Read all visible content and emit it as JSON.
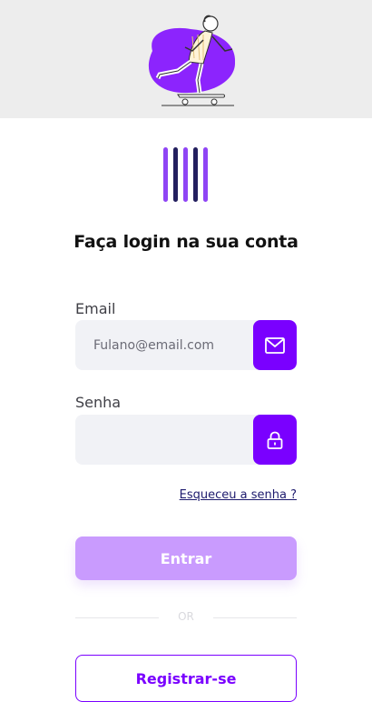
{
  "heading": "Faça login na sua conta",
  "email": {
    "label": "Email",
    "placeholder": "Fulano@email.com",
    "value": ""
  },
  "password": {
    "label": "Senha",
    "placeholder": "",
    "value": ""
  },
  "links": {
    "forgot_password": "Esqueceu a senha ?"
  },
  "buttons": {
    "login": "Entrar",
    "register": "Registrar-se"
  },
  "divider": "OR",
  "icons": {
    "email_icon": "envelope-icon",
    "password_icon": "lock-icon"
  },
  "colors": {
    "accent": "#7a00ff",
    "accent_light": "#c99bfe",
    "logo_dark": "#231f5e",
    "logo_light": "#8f45f5"
  }
}
